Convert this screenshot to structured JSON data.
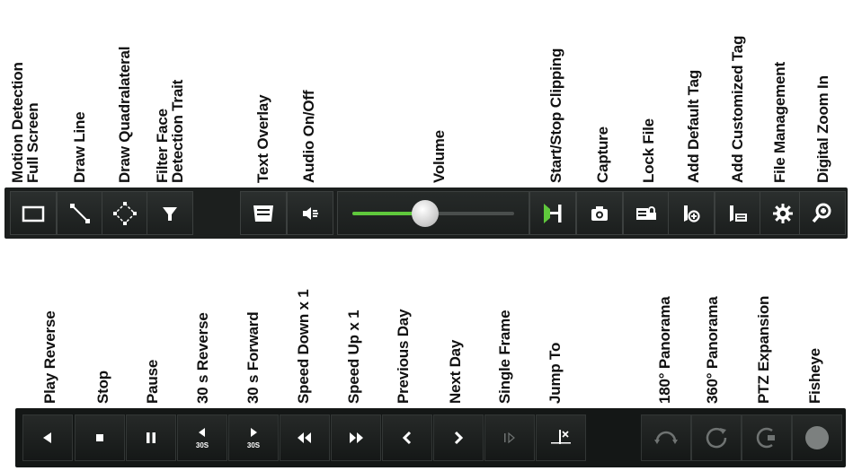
{
  "top_labels": [
    {
      "key": "full-screen",
      "lines": [
        "Motion Detection",
        "Full Screen"
      ]
    },
    {
      "key": "draw-line",
      "lines": [
        "Draw Line"
      ]
    },
    {
      "key": "draw-quadrilateral",
      "lines": [
        "Draw Quadralateral"
      ]
    },
    {
      "key": "filter",
      "lines": [
        "Filter Face",
        "Detection Trait"
      ]
    },
    {
      "key": "text-overlay",
      "lines": [
        "Text Overlay"
      ]
    },
    {
      "key": "audio",
      "lines": [
        "Audio On/Off"
      ]
    },
    {
      "key": "volume",
      "lines": [
        "Volume"
      ]
    },
    {
      "key": "clip",
      "lines": [
        "Start/Stop Clipping"
      ]
    },
    {
      "key": "capture",
      "lines": [
        "Capture"
      ]
    },
    {
      "key": "lock-file",
      "lines": [
        "Lock File"
      ]
    },
    {
      "key": "default-tag",
      "lines": [
        "Add Default Tag"
      ]
    },
    {
      "key": "custom-tag",
      "lines": [
        "Add Customized Tag"
      ]
    },
    {
      "key": "file-management",
      "lines": [
        "File Management"
      ]
    },
    {
      "key": "digital-zoom",
      "lines": [
        "Digital Zoom In"
      ]
    }
  ],
  "bottom_labels": [
    {
      "key": "play-reverse",
      "lines": [
        "Play Reverse"
      ]
    },
    {
      "key": "stop",
      "lines": [
        "Stop"
      ]
    },
    {
      "key": "pause",
      "lines": [
        "Pause"
      ]
    },
    {
      "key": "reverse-30",
      "lines": [
        "30 s Reverse"
      ]
    },
    {
      "key": "forward-30",
      "lines": [
        "30 s Forward"
      ]
    },
    {
      "key": "speed-down",
      "lines": [
        "Speed Down x 1"
      ]
    },
    {
      "key": "speed-up",
      "lines": [
        "Speed Up x 1"
      ]
    },
    {
      "key": "previous-day",
      "lines": [
        "Previous Day"
      ]
    },
    {
      "key": "next-day",
      "lines": [
        "Next Day"
      ]
    },
    {
      "key": "single-frame",
      "lines": [
        "Single Frame"
      ]
    },
    {
      "key": "jump-to",
      "lines": [
        "Jump To"
      ]
    },
    {
      "key": "panorama-180",
      "lines": [
        "180° Panorama"
      ]
    },
    {
      "key": "panorama-360",
      "lines": [
        "360° Panorama"
      ]
    },
    {
      "key": "ptz-expansion",
      "lines": [
        "PTZ Expansion"
      ]
    },
    {
      "key": "fisheye",
      "lines": [
        "Fisheye"
      ]
    }
  ],
  "skip_badges": {
    "reverse": "30S",
    "forward": "30S"
  },
  "volume": {
    "level": 0.45
  },
  "colors": {
    "bar": "#1c1f1e",
    "accent": "#5fc83c",
    "icon": "#ffffff",
    "icon_dim": "#6f7372"
  },
  "icons": {
    "full_screen": "rectangle-icon",
    "draw_line": "line-icon",
    "draw_quad": "diamond-icon",
    "filter": "funnel-icon",
    "text_overlay": "text-overlay-icon",
    "audio": "speaker-icon",
    "clip": "clip-icon",
    "capture": "camera-icon",
    "lock_file": "lock-file-icon",
    "default_tag": "tag-icon",
    "custom_tag": "custom-tag-icon",
    "file_management": "gear-icon",
    "digital_zoom": "zoom-in-icon"
  }
}
